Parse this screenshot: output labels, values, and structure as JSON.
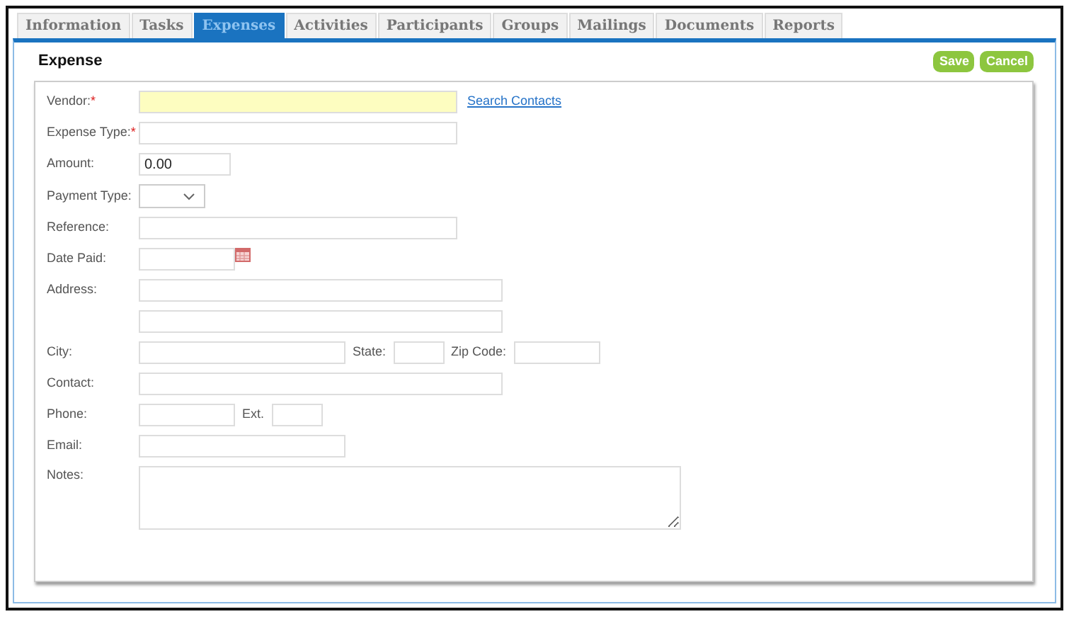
{
  "tabs": [
    {
      "label": "Information",
      "selected": false
    },
    {
      "label": "Tasks",
      "selected": false
    },
    {
      "label": "Expenses",
      "selected": true
    },
    {
      "label": "Activities",
      "selected": false
    },
    {
      "label": "Participants",
      "selected": false
    },
    {
      "label": "Groups",
      "selected": false
    },
    {
      "label": "Mailings",
      "selected": false
    },
    {
      "label": "Documents",
      "selected": false
    },
    {
      "label": "Reports",
      "selected": false
    }
  ],
  "panel": {
    "title": "Expense",
    "buttons": [
      "Save",
      "Cancel"
    ]
  },
  "form": [
    {
      "label": "Vendor:",
      "required_mark": "*",
      "items": [
        {
          "kind": "input",
          "focused": true
        },
        {
          "kind": "link",
          "text": "Search Contacts"
        }
      ]
    },
    {
      "label": "Expense Type:",
      "required_mark": "*",
      "items": [
        {
          "kind": "input",
          "focused": false
        }
      ]
    },
    {
      "label": "Amount:",
      "items": [
        {
          "kind": "input",
          "focused": false,
          "value": "0.00"
        }
      ]
    },
    {
      "label": "Payment Type:",
      "items": [
        {
          "kind": "select"
        }
      ]
    },
    {
      "label": "Reference:",
      "items": [
        {
          "kind": "input",
          "focused": false
        }
      ]
    },
    {
      "label": "Date Paid:",
      "items": [
        {
          "kind": "input",
          "focused": false
        },
        {
          "kind": "calendar"
        }
      ]
    },
    {
      "label": "Address:",
      "items": [
        {
          "kind": "input",
          "focused": false
        }
      ]
    },
    {
      "items": [
        {
          "kind": "input",
          "focused": false
        }
      ]
    },
    {
      "label": "City:",
      "items": [
        {
          "kind": "input",
          "focused": false
        },
        {
          "kind": "label",
          "text": "State:"
        },
        {
          "kind": "input",
          "focused": false
        },
        {
          "kind": "label",
          "text": "Zip Code:"
        },
        {
          "kind": "input",
          "focused": false
        }
      ]
    },
    {
      "label": "Contact:",
      "items": [
        {
          "kind": "input",
          "focused": false
        }
      ]
    },
    {
      "label": "Phone:",
      "items": [
        {
          "kind": "input",
          "focused": false
        },
        {
          "kind": "label",
          "text": "Ext."
        },
        {
          "kind": "input",
          "focused": false
        }
      ]
    },
    {
      "label": "Email:",
      "items": [
        {
          "kind": "input",
          "focused": false
        }
      ]
    },
    {
      "label": "Notes:",
      "items": [
        {
          "kind": "textarea"
        }
      ]
    }
  ]
}
